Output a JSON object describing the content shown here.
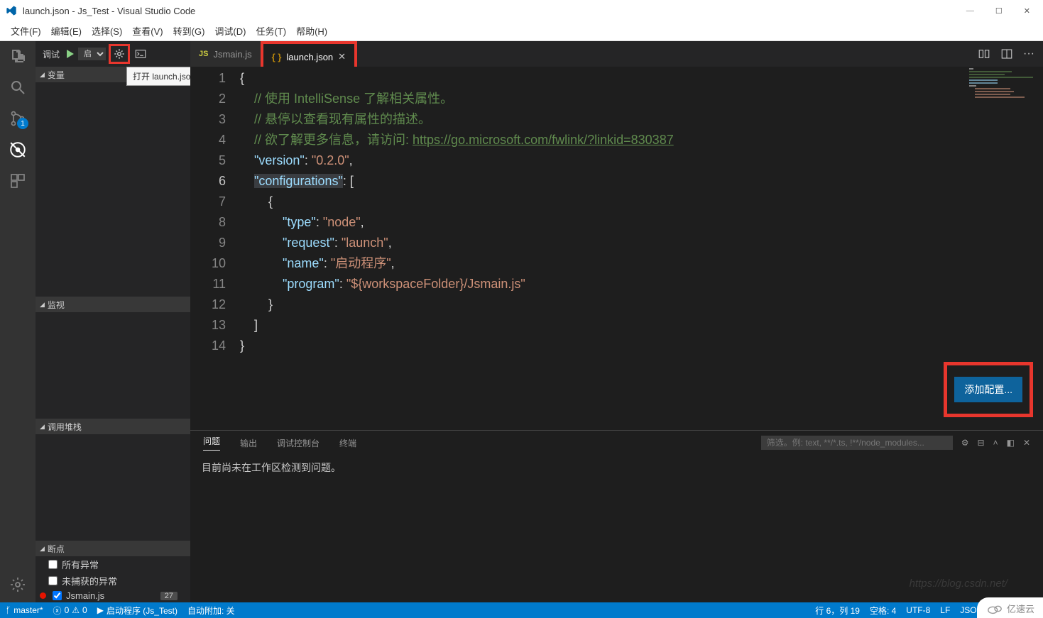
{
  "window": {
    "title": "launch.json - Js_Test - Visual Studio Code",
    "min": "—",
    "max": "☐",
    "close": "✕"
  },
  "menu": {
    "file": "文件(F)",
    "edit": "编辑(E)",
    "select": "选择(S)",
    "view": "查看(V)",
    "goto": "转到(G)",
    "debug": "调试(D)",
    "tasks": "任务(T)",
    "help": "帮助(H)"
  },
  "activity": {
    "scm_badge": "1"
  },
  "sidebar": {
    "debug_label": "调试",
    "config_selected": "启",
    "tooltip": "打开 launch.json",
    "sec_vars": "变量",
    "sec_watch": "监视",
    "sec_callstack": "调用堆栈",
    "sec_bp": "断点",
    "bp_all": "所有异常",
    "bp_uncaught": "未捕获的异常",
    "bp_file": "Jsmain.js",
    "bp_count": "27"
  },
  "tabs": {
    "tab1": "Jsmain.js",
    "tab2": "launch.json"
  },
  "editor": {
    "lines": [
      "1",
      "2",
      "3",
      "4",
      "5",
      "6",
      "7",
      "8",
      "9",
      "10",
      "11",
      "12",
      "13",
      "14"
    ],
    "c1": "// 使用 IntelliSense 了解相关属性。",
    "c2": "// 悬停以查看现有属性的描述。",
    "c3_pre": "// 欲了解更多信息，请访问: ",
    "c3_link": "https://go.microsoft.com/fwlink/?linkid=830387",
    "k_version": "\"version\"",
    "v_version": "\"0.2.0\"",
    "k_config": "\"configurations\"",
    "k_type": "\"type\"",
    "v_type": "\"node\"",
    "k_request": "\"request\"",
    "v_request": "\"launch\"",
    "k_name": "\"name\"",
    "v_name": "\"启动程序\"",
    "k_program": "\"program\"",
    "v_program": "\"${workspaceFolder}/Jsmain.js\"",
    "add_config": "添加配置..."
  },
  "panel": {
    "t_problems": "问题",
    "t_output": "输出",
    "t_debugconsole": "调试控制台",
    "t_terminal": "终端",
    "filter_placeholder": "筛选。例: text, **/*.ts, !**/node_modules...",
    "msg": "目前尚未在工作区检测到问题。"
  },
  "statusbar": {
    "branch": "master*",
    "errors": "0",
    "warnings": "0",
    "launch": "启动程序 (Js_Test)",
    "autoattach": "自动附加: 关",
    "pos": "行 6，列 19",
    "spaces": "空格: 4",
    "encoding": "UTF-8",
    "eol": "LF",
    "lang": "JSON with Commen"
  },
  "watermark": "https://blog.csdn.net/",
  "yisu": "亿速云"
}
